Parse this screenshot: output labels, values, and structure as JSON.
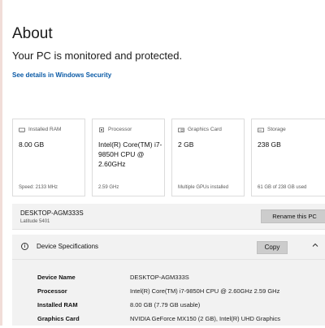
{
  "page": {
    "title": "About",
    "status": "Your PC is monitored and protected.",
    "security_link": "See details in Windows Security"
  },
  "cards": [
    {
      "icon": "ram-icon",
      "label": "Installed RAM",
      "value": "8.00 GB",
      "footer": "Speed: 2133 MHz"
    },
    {
      "icon": "processor-icon",
      "label": "Processor",
      "value": "Intel(R) Core(TM) i7-9850H CPU @ 2.60GHz",
      "footer": "2.59 GHz"
    },
    {
      "icon": "graphics-card-icon",
      "label": "Graphics Card",
      "value": "2 GB",
      "footer": "Multiple GPUs installed"
    },
    {
      "icon": "storage-icon",
      "label": "Storage",
      "value": "238 GB",
      "footer": "61 GB of 238 GB used"
    }
  ],
  "device": {
    "name": "DESKTOP-AGM333S",
    "model": "Latitude 5401",
    "rename_label": "Rename this PC"
  },
  "specs": {
    "title": "Device Specifications",
    "copy_label": "Copy",
    "rows": [
      {
        "key": "Device Name",
        "value": "DESKTOP-AGM333S"
      },
      {
        "key": "Processor",
        "value": "Intel(R) Core(TM) i7-9850H CPU @ 2.60GHz   2.59 GHz"
      },
      {
        "key": "Installed RAM",
        "value": "8.00 GB (7.79 GB usable)"
      },
      {
        "key": "Graphics Card",
        "value": "NVIDIA GeForce MX150 (2 GB), Intel(R) UHD Graphics"
      }
    ]
  },
  "colors": {
    "link": "#0a5aa6",
    "panel_bg": "#f2f2f2",
    "button_bg": "#cccccc",
    "card_border": "#dcdcdc"
  }
}
